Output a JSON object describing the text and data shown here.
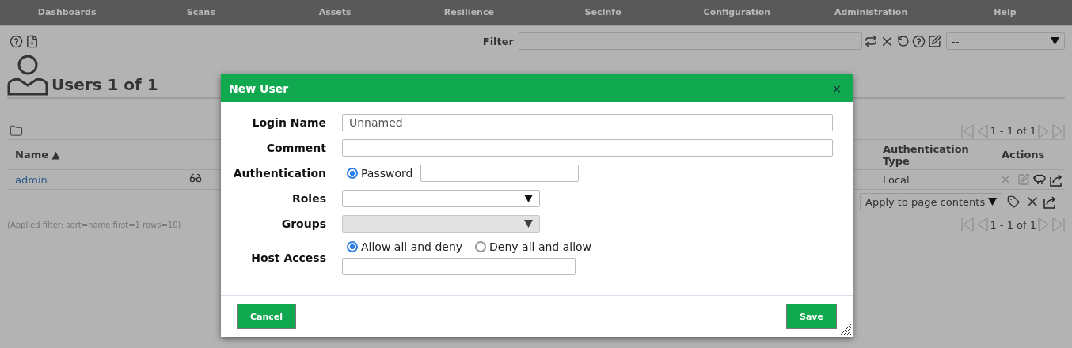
{
  "nav": [
    "Dashboards",
    "Scans",
    "Assets",
    "Resilience",
    "SecInfo",
    "Configuration",
    "Administration",
    "Help"
  ],
  "toolbar": {
    "filter_label": "Filter",
    "filter_select": "--"
  },
  "page_title": "Users 1 of 1",
  "pagination_top": "1 - 1 of 1",
  "table": {
    "columns": [
      "Name ▲",
      "Authentication Type",
      "Actions"
    ],
    "rows": [
      {
        "name": "admin",
        "auth_type": "Local"
      }
    ]
  },
  "bulk_action": "Apply to page contents",
  "applied_filter": "(Applied filter: sort=name first=1 rows=10)",
  "pagination_bottom": "1 - 1 of 1",
  "dialog": {
    "title": "New User",
    "close": "×",
    "fields": [
      {
        "kind": "text",
        "label": "Login Name",
        "value": "Unnamed"
      },
      {
        "kind": "text",
        "label": "Comment"
      },
      {
        "kind": "auth",
        "label": "Authentication",
        "option": {
          "label": "Password",
          "selected": true
        }
      },
      {
        "kind": "select",
        "label": "Roles",
        "disabled": false
      },
      {
        "kind": "select",
        "label": "Groups",
        "disabled": true
      },
      {
        "kind": "host",
        "label": "Host Access",
        "options": [
          {
            "label": "Allow all and deny",
            "selected": true
          },
          {
            "label": "Deny all and allow",
            "selected": false
          }
        ]
      }
    ],
    "buttons": [
      "Cancel",
      "Save"
    ]
  }
}
